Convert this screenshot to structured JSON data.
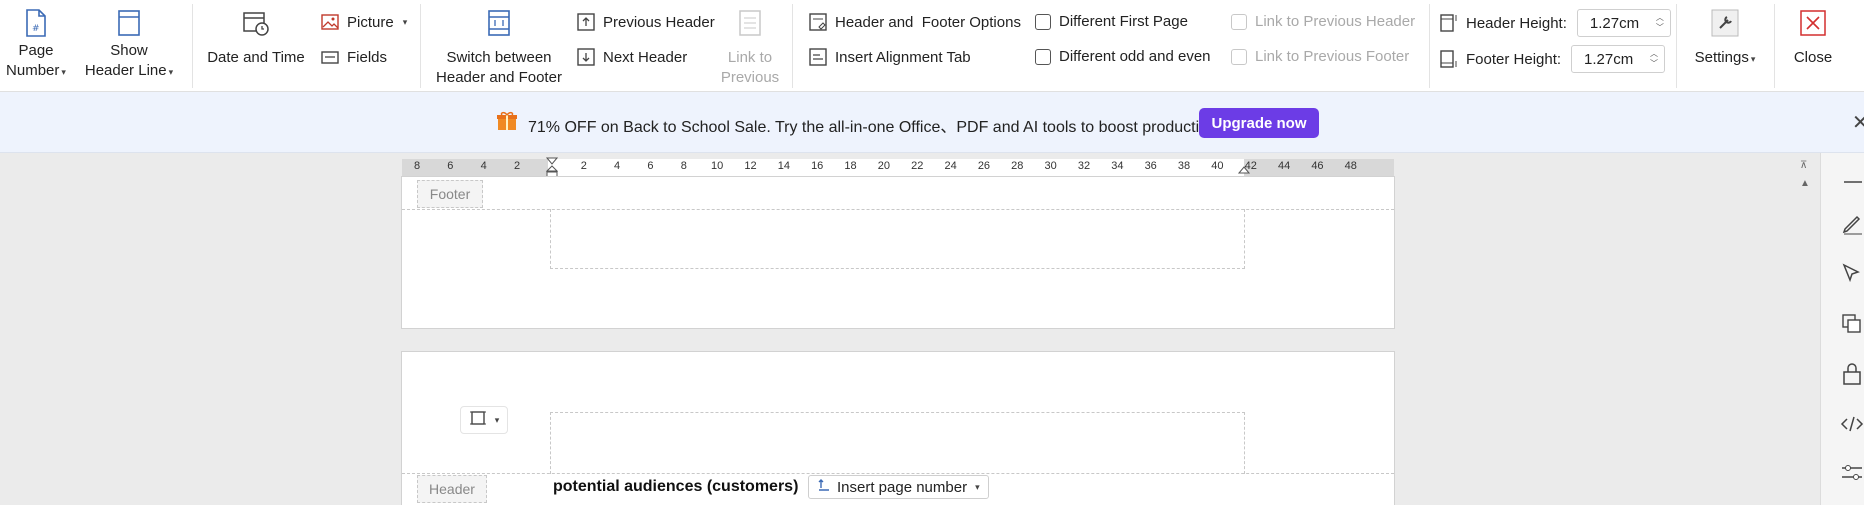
{
  "ribbon": {
    "page_number": [
      "Page",
      "Number"
    ],
    "show_header_line": [
      "Show",
      "Header Line"
    ],
    "date_and_time": "Date and Time",
    "picture": "Picture",
    "fields": "Fields",
    "switch_header_footer": [
      "Switch between",
      "Header and Footer"
    ],
    "previous_header": "Previous Header",
    "next_header": "Next Header",
    "link_to_previous": [
      "Link to",
      "Previous"
    ],
    "header_footer_options": "Header and  Footer Options",
    "insert_alignment_tab": "Insert Alignment Tab",
    "different_first_page": "Different First Page",
    "different_odd_even": "Different odd and even",
    "link_prev_header": "Link to Previous Header",
    "link_prev_footer": "Link to Previous Footer",
    "header_height_label": "Header Height:",
    "header_height_value": "1.27cm",
    "footer_height_label": "Footer Height:",
    "footer_height_value": "1.27cm",
    "settings": "Settings",
    "close": "Close"
  },
  "promo": {
    "text": "71% OFF on Back to School Sale. Try the all-in-one Office、PDF and AI tools to boost productivity.",
    "button": "Upgrade now"
  },
  "ruler": {
    "ticks": [
      "8",
      "6",
      "4",
      "2",
      "2",
      "4",
      "6",
      "8",
      "10",
      "12",
      "14",
      "16",
      "18",
      "20",
      "22",
      "24",
      "26",
      "28",
      "30",
      "32",
      "34",
      "36",
      "38",
      "40",
      "42",
      "44",
      "46",
      "48"
    ]
  },
  "document": {
    "footer_tag": "Footer",
    "header_tag": "Header",
    "body_line": "potential audiences (customers)",
    "insert_page_number": "Insert page number"
  },
  "colors": {
    "accent": "#6c3ce6",
    "close_red": "#d32f2f"
  }
}
